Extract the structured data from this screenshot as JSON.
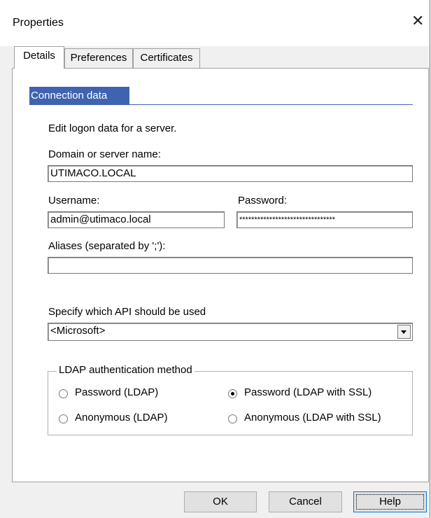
{
  "window": {
    "title": "Properties",
    "close_glyph": "✕"
  },
  "tabs": [
    {
      "label": "Details",
      "active": true
    },
    {
      "label": "Preferences",
      "active": false
    },
    {
      "label": "Certificates",
      "active": false
    }
  ],
  "section": {
    "header": "Connection data",
    "description": "Edit logon data for a server."
  },
  "fields": {
    "domain": {
      "label": "Domain or server name:",
      "value": "UTIMACO.LOCAL"
    },
    "username": {
      "label": "Username:",
      "value": "admin@utimaco.local"
    },
    "password": {
      "label": "Password:",
      "value": "********************************"
    },
    "aliases": {
      "label": "Aliases (separated by ';'):",
      "value": ""
    }
  },
  "api": {
    "label": "Specify which API should be used",
    "selected": "<Microsoft>"
  },
  "ldap": {
    "title": "LDAP authentication method",
    "options": [
      {
        "label": "Password (LDAP)",
        "checked": false
      },
      {
        "label": "Password (LDAP with SSL)",
        "checked": true
      },
      {
        "label": "Anonymous (LDAP)",
        "checked": false
      },
      {
        "label": "Anonymous (LDAP with SSL)",
        "checked": false
      }
    ]
  },
  "buttons": {
    "ok": "OK",
    "cancel": "Cancel",
    "help": "Help"
  },
  "colors": {
    "section_header": "#3f63b0",
    "dialog_bg": "#f0f0f0",
    "default_button_border": "#0078d7"
  }
}
